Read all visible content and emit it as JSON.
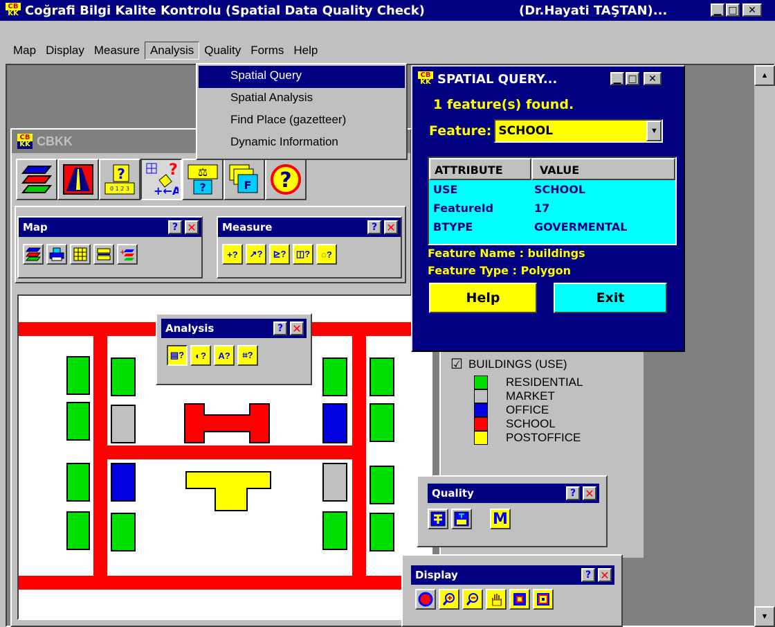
{
  "window": {
    "title": "Coğrafi Bilgi Kalite Kontrolu (Spatial Data Quality Check)",
    "author": "(Dr.Hayati TAŞTAN)...",
    "logo_top": "CB",
    "logo_bottom": "KK",
    "btn_min": "▁",
    "btn_max": "□",
    "btn_close": "✕"
  },
  "menu": [
    "Map",
    "Display",
    "Measure",
    "Analysis",
    "Quality",
    "Forms",
    "Help"
  ],
  "analysis_menu": [
    "Spatial Query",
    "Spatial Analysis",
    "Find Place (gazetteer)",
    "Dynamic Information"
  ],
  "cbkk": {
    "title": "CBKK"
  },
  "toolbars": {
    "map": {
      "title": "Map",
      "help": "?",
      "close": "✕"
    },
    "measure": {
      "title": "Measure",
      "help": "?",
      "close": "✕"
    },
    "analysis": {
      "title": "Analysis",
      "help": "?",
      "close": "✕"
    },
    "quality": {
      "title": "Quality",
      "help": "?",
      "close": "✕"
    },
    "display": {
      "title": "Display",
      "help": "?",
      "close": "✕"
    }
  },
  "measure_icons": [
    "+?",
    "↗?",
    "⊵?",
    "◫?",
    "◌?"
  ],
  "analysis_icons": [
    "▤?",
    "◐?",
    "A?",
    "⌗?"
  ],
  "big_icon_q": "?",
  "big_icon_f": "F",
  "big_icon_scale": "0 1 2 3",
  "big_icon_arrows": "+←A",
  "quality_m": "M",
  "legend": {
    "layer": "BUILDINGS (USE)",
    "check": "☑",
    "items": [
      {
        "label": "RESIDENTIAL",
        "color": "#00e000"
      },
      {
        "label": "MARKET",
        "color": "#c0c0c0"
      },
      {
        "label": "OFFICE",
        "color": "#0000e0"
      },
      {
        "label": "SCHOOL",
        "color": "#ff0000"
      },
      {
        "label": "POSTOFFICE",
        "color": "#ffff00"
      }
    ]
  },
  "query": {
    "title": "SPATIAL QUERY...",
    "found": "1 feature(s) found.",
    "feature_label": "Feature:",
    "feature_value": "SCHOOL",
    "col_attr": "ATTRIBUTE",
    "col_val": "VALUE",
    "rows": [
      {
        "attr": "USE",
        "val": "SCHOOL"
      },
      {
        "attr": "FeatureId",
        "val": "17"
      },
      {
        "attr": "BTYPE",
        "val": "GOVERMENTAL"
      }
    ],
    "name_line": "Feature Name : buildings",
    "type_line": "Feature Type : Polygon",
    "help": "Help",
    "exit": "Exit"
  },
  "scroll": {
    "up": "▲",
    "down": "▼"
  }
}
